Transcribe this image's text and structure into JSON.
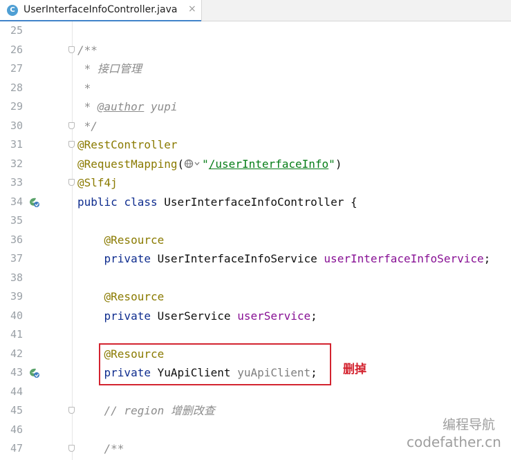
{
  "tab": {
    "icon": "C",
    "title": "UserInterfaceInfoController.java",
    "close": "×"
  },
  "lines": [
    {
      "n": "25"
    },
    {
      "n": "26",
      "t": [
        "/**"
      ]
    },
    {
      "n": "27",
      "t": [
        " * 接口管理"
      ]
    },
    {
      "n": "28",
      "t": [
        " *"
      ]
    },
    {
      "n": "29",
      "t": [
        " * ",
        "@author",
        " yupi"
      ]
    },
    {
      "n": "30",
      "t": [
        " */"
      ]
    },
    {
      "n": "31",
      "t": [
        "@RestController"
      ]
    },
    {
      "n": "32",
      "t": [
        "@RequestMapping",
        "(",
        "\"",
        "/userInterfaceInfo",
        "\"",
        ")"
      ]
    },
    {
      "n": "33",
      "t": [
        "@Slf4j"
      ]
    },
    {
      "n": "34",
      "t": [
        "public",
        " ",
        "class",
        " UserInterfaceInfoController {"
      ]
    },
    {
      "n": "35"
    },
    {
      "n": "36",
      "t": [
        "    ",
        "@Resource"
      ]
    },
    {
      "n": "37",
      "t": [
        "    ",
        "private",
        " UserInterfaceInfoService ",
        "userInterfaceInfoService",
        ";"
      ]
    },
    {
      "n": "38"
    },
    {
      "n": "39",
      "t": [
        "    ",
        "@Resource"
      ]
    },
    {
      "n": "40",
      "t": [
        "    ",
        "private",
        " UserService ",
        "userService",
        ";"
      ]
    },
    {
      "n": "41"
    },
    {
      "n": "42",
      "t": [
        "    ",
        "@Resource"
      ]
    },
    {
      "n": "43",
      "t": [
        "    ",
        "private",
        " YuApiClient ",
        "yuApiClient",
        ";"
      ]
    },
    {
      "n": "44"
    },
    {
      "n": "45",
      "t": [
        "    ",
        "// region 增删改查"
      ]
    },
    {
      "n": "46"
    },
    {
      "n": "47",
      "t": [
        "    ",
        "/**"
      ]
    }
  ],
  "annotation": {
    "note": "删掉"
  },
  "watermark": {
    "line1": "编程导航",
    "line2": "codefather.cn"
  },
  "icons": {
    "tab": "java-class-icon",
    "gutter": "spring-bean-icon",
    "mapping": "globe-icon"
  },
  "colors": {
    "keyword": "#0e2c8e",
    "annotation": "#8a7a00",
    "comment": "#8c8c8c",
    "string": "#067d17",
    "field": "#871094",
    "highlight_box": "#d3232f"
  }
}
